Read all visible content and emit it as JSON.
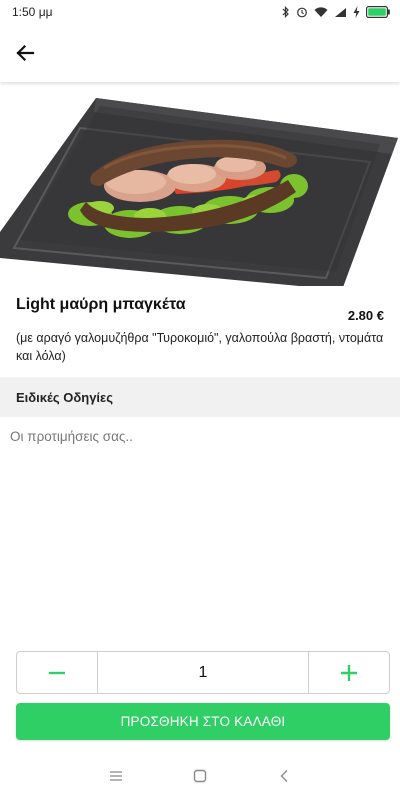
{
  "status_bar": {
    "time": "1:50 μμ",
    "battery_icon": "battery-icon",
    "wifi_icon": "wifi-icon",
    "signal_icon": "signal-icon",
    "bluetooth_icon": "bluetooth-icon"
  },
  "app_bar": {
    "back_icon": "arrow-left-icon"
  },
  "product": {
    "name": "Light μαύρη μπαγκέτα",
    "price": "2.80 €",
    "description": "(με αραγό γαλομυζήθρα \"Τυροκομιό\", γαλοπούλα βραστή, ντομάτα και λόλα)"
  },
  "instructions": {
    "header": "Ειδικές Οδηγίες",
    "placeholder": "Οι προτιμήσεις σας.."
  },
  "quantity": {
    "value": "1",
    "minus_icon": "minus-icon",
    "plus_icon": "plus-icon"
  },
  "cart": {
    "add_label": "ΠΡΟΣΘΗΚΗ ΣΤΟ ΚΑΛΑΘΙ"
  },
  "colors": {
    "accent": "#2fcf66",
    "section_bg": "#f1f1f1"
  }
}
